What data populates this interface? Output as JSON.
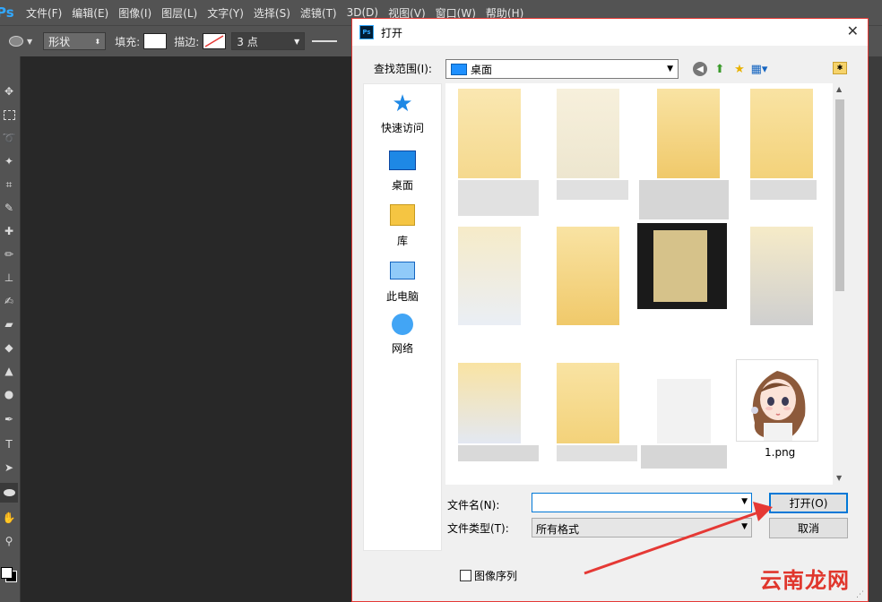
{
  "app": {
    "logo_text": "Ps",
    "menu": [
      "文件(F)",
      "编辑(E)",
      "图像(I)",
      "图层(L)",
      "文字(Y)",
      "选择(S)",
      "滤镜(T)",
      "3D(D)",
      "视图(V)",
      "窗口(W)",
      "帮助(H)"
    ]
  },
  "options_bar": {
    "shape_mode": "形状",
    "fill_label": "填充:",
    "stroke_label": "描边:",
    "stroke_width": "3 点"
  },
  "tools": [
    "move-icon",
    "marquee-icon",
    "lasso-icon",
    "magic-wand-icon",
    "crop-icon",
    "eyedropper-icon",
    "healing-icon",
    "brush-icon",
    "stamp-icon",
    "history-brush-icon",
    "eraser-icon",
    "bucket-icon",
    "blur-icon",
    "dodge-icon",
    "pen-icon",
    "type-icon",
    "path-select-icon",
    "ellipse-icon",
    "hand-icon",
    "zoom-icon"
  ],
  "dialog": {
    "title": "打开",
    "look_in_label": "查找范围(I):",
    "look_in_value": "桌面",
    "places": [
      {
        "label": "快速访问",
        "icon": "star-icon"
      },
      {
        "label": "桌面",
        "icon": "desktop-icon"
      },
      {
        "label": "库",
        "icon": "library-icon"
      },
      {
        "label": "此电脑",
        "icon": "computer-icon"
      },
      {
        "label": "网络",
        "icon": "network-icon"
      }
    ],
    "files": [
      {
        "name": "1.png"
      }
    ],
    "filename_label": "文件名(N):",
    "filename_value": "",
    "filetype_label": "文件类型(T):",
    "filetype_value": "所有格式",
    "open_button": "打开(O)",
    "cancel_button": "取消",
    "image_sequence_label": "图像序列"
  },
  "watermark": "云南龙网",
  "colors": {
    "accent_red": "#e53935",
    "ps_dark": "#535353",
    "canvas": "#282828"
  }
}
